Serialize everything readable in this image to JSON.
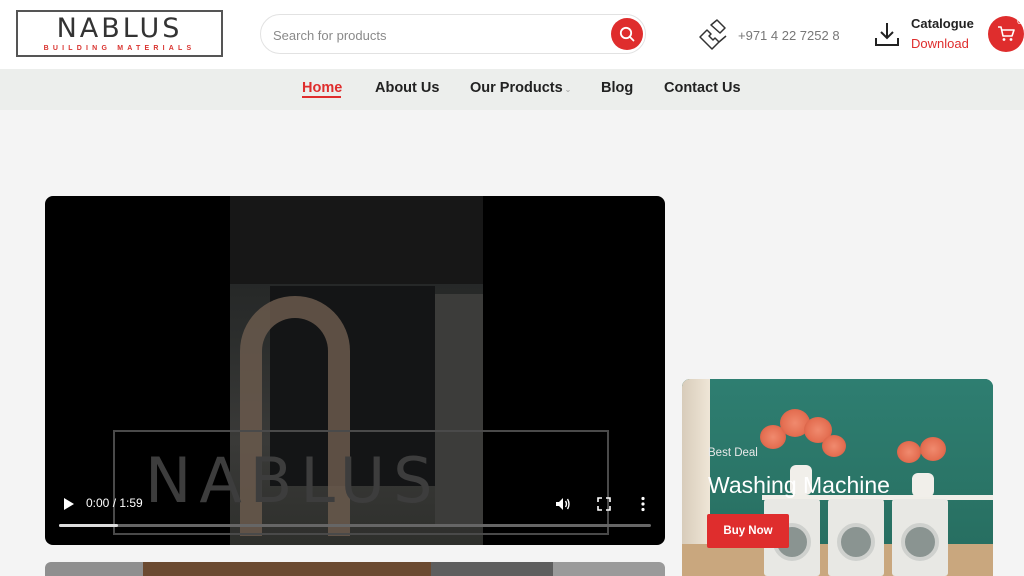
{
  "header": {
    "logo": {
      "main": "NABLUS",
      "sub": "BUILDING MATERIALS"
    },
    "search": {
      "placeholder": "Search for products"
    },
    "phone": "+971 4 22 7252 8",
    "catalogue": {
      "title": "Catalogue",
      "link": "Download"
    },
    "cart": {
      "count": "0"
    }
  },
  "nav": {
    "items": [
      {
        "label": "Home"
      },
      {
        "label": "About Us"
      },
      {
        "label": "Our Products"
      },
      {
        "label": "Blog"
      },
      {
        "label": "Contact Us"
      }
    ],
    "active_index": 0
  },
  "video": {
    "time": "0:00 / 1:59",
    "progress_fraction": 0.1,
    "watermark": "NABLUS"
  },
  "promo": {
    "kicker": "Best Deal",
    "title": "Washing Machine",
    "cta": "Buy Now"
  },
  "colors": {
    "accent": "#df2d2d",
    "nav_bg": "#eceeec",
    "page_bg": "#f4f4f4"
  }
}
